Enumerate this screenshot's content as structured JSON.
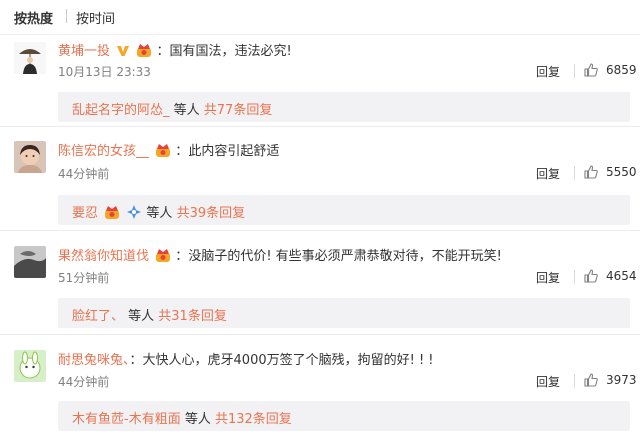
{
  "sort": {
    "hot": "按热度",
    "time": "按时间"
  },
  "comments": [
    {
      "name": "黄埔一投",
      "colon": "：",
      "text": "国有国法，违法必究!",
      "time": "10月13日 23:33",
      "reply": "回复",
      "likes": "6859",
      "sub": {
        "names": "乱起名字的阿怂_",
        "mid": " 等人 ",
        "count": "共77条回复"
      }
    },
    {
      "name": "陈信宏的女孩__",
      "colon": "：",
      "text": "此内容引起舒适",
      "time": "44分钟前",
      "reply": "回复",
      "likes": "5550",
      "sub": {
        "names": "要忍",
        "mid": " 等人 ",
        "count": "共39条回复"
      }
    },
    {
      "name": "果然翁你知道伐",
      "colon": "：",
      "text": "没脑子的代价! 有些事必须严肃恭敬对待，不能开玩笑!",
      "time": "51分钟前",
      "reply": "回复",
      "likes": "4654",
      "sub": {
        "names": "脸红了、",
        "mid": " 等人 ",
        "count": "共31条回复"
      }
    },
    {
      "name": "耐思兔咪兔、",
      "colon": "：",
      "text": "大快人心，虎牙4000万签了个脑残，拘留的好! ! !",
      "time": "44分钟前",
      "reply": "回复",
      "likes": "3973",
      "sub": {
        "names": "木有鱼苉-木有粗面",
        "mid": " 等人 ",
        "count": "共132条回复"
      }
    }
  ],
  "colors": {
    "username": "#eb7350",
    "badge_gold": "#f5a623",
    "badge_red": "#e8403a",
    "subbox_bg": "#f2f2f5"
  },
  "icons": [
    "verified-v-icon",
    "crown-badge-icon",
    "blue-flower-icon",
    "thumb-up-icon"
  ]
}
